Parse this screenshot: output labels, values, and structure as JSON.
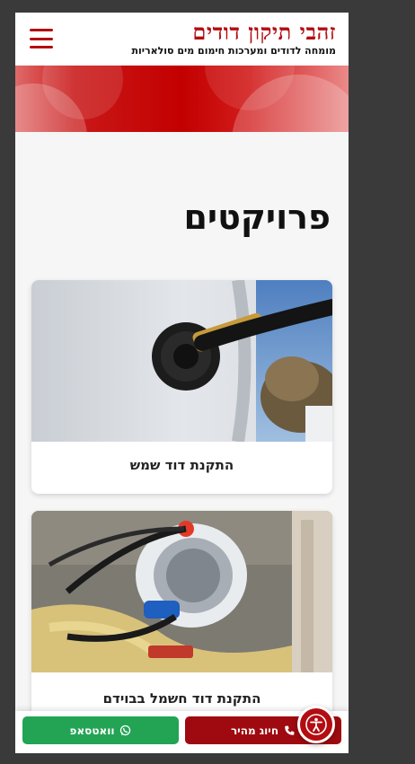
{
  "header": {
    "title": "זהבי תיקון דודים",
    "subtitle": "מומחה לדודים ומערכות חימום מים סולאריות",
    "menu_icon": "hamburger-menu-icon"
  },
  "colors": {
    "brand_red": "#b30d12",
    "call_red": "#9e0a0f",
    "whatsapp_green": "#23a455"
  },
  "page": {
    "title": "פרויקטים"
  },
  "projects": [
    {
      "title": "התקנת דוד שמש"
    },
    {
      "title": "התקנת דוד חשמל בבוידם"
    }
  ],
  "bottom_bar": {
    "whatsapp_label": "וואטסאפ",
    "whatsapp_icon": "whatsapp-icon",
    "call_label": "חיוג מהיר",
    "call_icon": "phone-icon"
  },
  "accessibility": {
    "icon": "accessibility-icon"
  }
}
